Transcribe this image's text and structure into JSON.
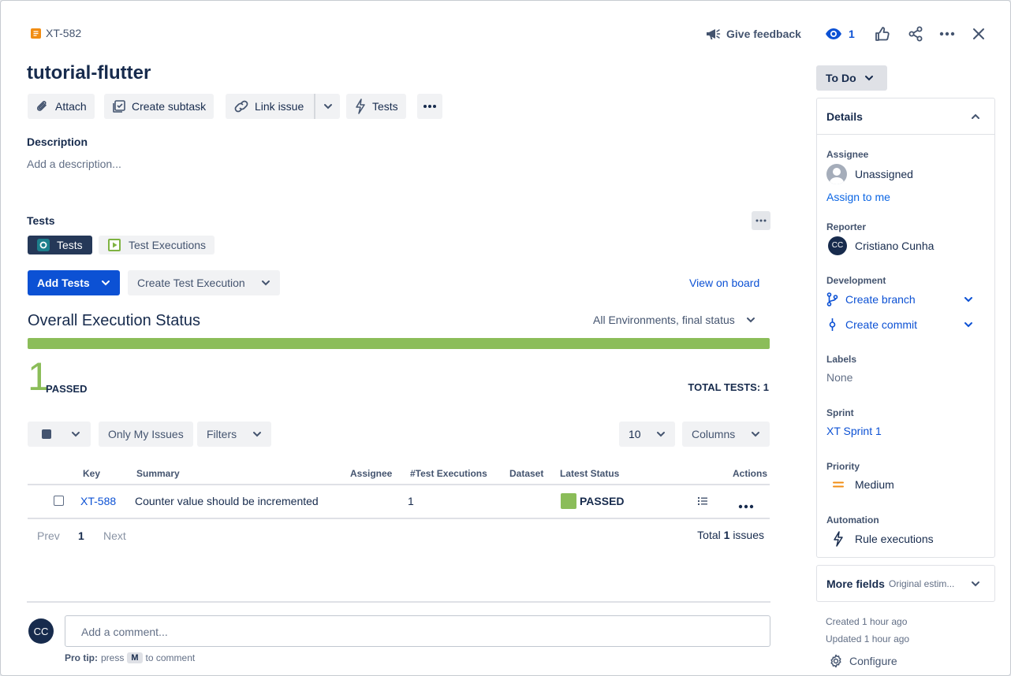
{
  "header": {
    "issue_key": "XT-582",
    "feedback_label": "Give feedback",
    "watch_count": "1"
  },
  "issue": {
    "title": "tutorial-flutter",
    "status": "To Do"
  },
  "toolbar": {
    "attach": "Attach",
    "create_subtask": "Create subtask",
    "link_issue": "Link issue",
    "tests": "Tests"
  },
  "description": {
    "heading": "Description",
    "placeholder": "Add a description..."
  },
  "tests_panel": {
    "heading": "Tests",
    "tabs": [
      {
        "label": "Tests",
        "active": true
      },
      {
        "label": "Test Executions",
        "active": false
      }
    ],
    "add_tests": "Add Tests",
    "create_test_execution": "Create Test Execution",
    "view_on_board": "View on board",
    "overall_title": "Overall Execution Status",
    "env_filter": "All Environments, final status",
    "progress_passed_fraction": 1.0,
    "passed_count": "1",
    "passed_label": "PASSED",
    "total_tests": "TOTAL TESTS: 1",
    "only_my_issues": "Only My Issues",
    "filters": "Filters",
    "page_size": "10",
    "columns": "Columns",
    "table": {
      "headers": [
        "Key",
        "Summary",
        "Assignee",
        "#Test Executions",
        "Dataset",
        "Latest Status",
        "Actions"
      ],
      "rows": [
        {
          "key": "XT-588",
          "summary": "Counter value should be incremented",
          "assignee": "",
          "executions": "1",
          "dataset": "",
          "status": "PASSED"
        }
      ]
    },
    "pagination": {
      "prev": "Prev",
      "current": "1",
      "next": "Next",
      "total_prefix": "Total",
      "total_count": "1",
      "total_suffix": "issues"
    }
  },
  "comment": {
    "avatar_initials": "CC",
    "placeholder": "Add a comment...",
    "tip_bold": "Pro tip:",
    "tip_press": "press",
    "tip_key": "M",
    "tip_suffix": "to comment"
  },
  "details": {
    "heading": "Details",
    "assignee_label": "Assignee",
    "assignee_value": "Unassigned",
    "assign_to_me": "Assign to me",
    "reporter_label": "Reporter",
    "reporter_initials": "CC",
    "reporter_value": "Cristiano Cunha",
    "development_label": "Development",
    "create_branch": "Create branch",
    "create_commit": "Create commit",
    "labels_label": "Labels",
    "labels_value": "None",
    "sprint_label": "Sprint",
    "sprint_value": "XT Sprint 1",
    "priority_label": "Priority",
    "priority_value": "Medium",
    "automation_label": "Automation",
    "automation_value": "Rule executions"
  },
  "more_fields": {
    "heading": "More fields",
    "subtitle": "Original estim..."
  },
  "meta": {
    "created": "Created 1 hour ago",
    "updated": "Updated 1 hour ago",
    "configure": "Configure"
  },
  "colors": {
    "passed": "#8bbd59",
    "primary": "#0c51d4",
    "link": "#0c66e4",
    "story_icon": "#f18d13"
  }
}
